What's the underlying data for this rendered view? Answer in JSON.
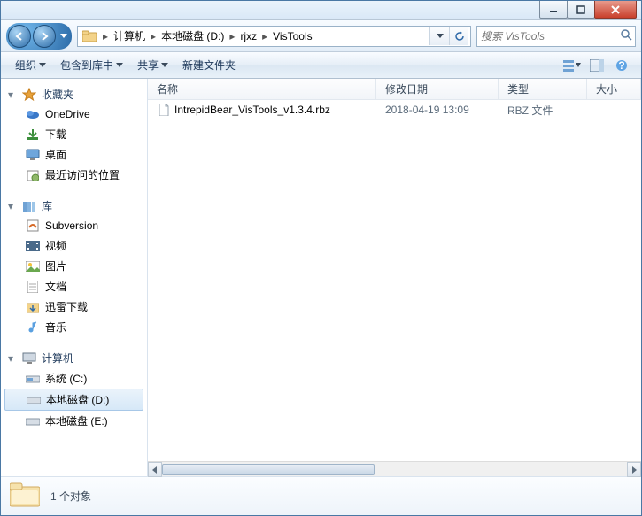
{
  "breadcrumb": [
    "计算机",
    "本地磁盘 (D:)",
    "rjxz",
    "VisTools"
  ],
  "search": {
    "placeholder": "搜索 VisTools"
  },
  "toolbar": {
    "organize": "组织",
    "include": "包含到库中",
    "share": "共享",
    "newfolder": "新建文件夹"
  },
  "sidebar": {
    "favorites": {
      "label": "收藏夹",
      "items": [
        "OneDrive",
        "下载",
        "桌面",
        "最近访问的位置"
      ]
    },
    "libraries": {
      "label": "库",
      "items": [
        "Subversion",
        "视频",
        "图片",
        "文档",
        "迅雷下载",
        "音乐"
      ]
    },
    "computer": {
      "label": "计算机",
      "items": [
        "系统 (C:)",
        "本地磁盘 (D:)",
        "本地磁盘 (E:)"
      ]
    }
  },
  "columns": {
    "name": "名称",
    "date": "修改日期",
    "type": "类型",
    "size": "大小"
  },
  "files": [
    {
      "name": "IntrepidBear_VisTools_v1.3.4.rbz",
      "date": "2018-04-19 13:09",
      "type": "RBZ 文件",
      "size": ""
    }
  ],
  "status": {
    "text": "1 个对象"
  }
}
